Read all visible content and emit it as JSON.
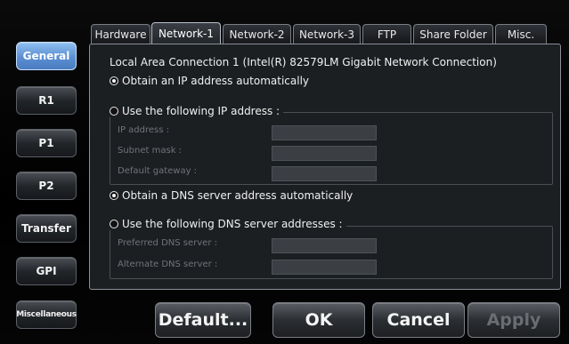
{
  "sidebar": {
    "items": [
      {
        "label": "General",
        "active": true
      },
      {
        "label": "R1"
      },
      {
        "label": "P1"
      },
      {
        "label": "P2"
      },
      {
        "label": "Transfer"
      },
      {
        "label": "GPI"
      },
      {
        "label": "Miscellaneous"
      }
    ]
  },
  "tabs": [
    {
      "label": "Hardware"
    },
    {
      "label": "Network-1",
      "active": true
    },
    {
      "label": "Network-2"
    },
    {
      "label": "Network-3"
    },
    {
      "label": "FTP"
    },
    {
      "label": "Share Folder"
    },
    {
      "label": "Misc."
    }
  ],
  "network": {
    "connection_title": "Local Area Connection 1 (Intel(R) 82579LM Gigabit Network Connection)",
    "ip_auto_label": "Obtain an IP address automatically",
    "ip_auto_selected": true,
    "ip_manual_label": "Use the following IP address :",
    "ip_address_label": "IP address :",
    "subnet_mask_label": "Subnet mask :",
    "gateway_label": "Default gateway :",
    "dns_auto_label": "Obtain a DNS server address automatically",
    "dns_auto_selected": true,
    "dns_manual_label": "Use the following DNS server addresses :",
    "preferred_dns_label": "Preferred DNS server :",
    "alternate_dns_label": "Alternate DNS server :"
  },
  "buttons": {
    "default": "Default...",
    "ok": "OK",
    "cancel": "Cancel",
    "apply": "Apply"
  },
  "colors": {
    "active_side": "#5b8fd2",
    "panel_bg": "#1c1f22",
    "disabled_text": "#6a6e73"
  }
}
